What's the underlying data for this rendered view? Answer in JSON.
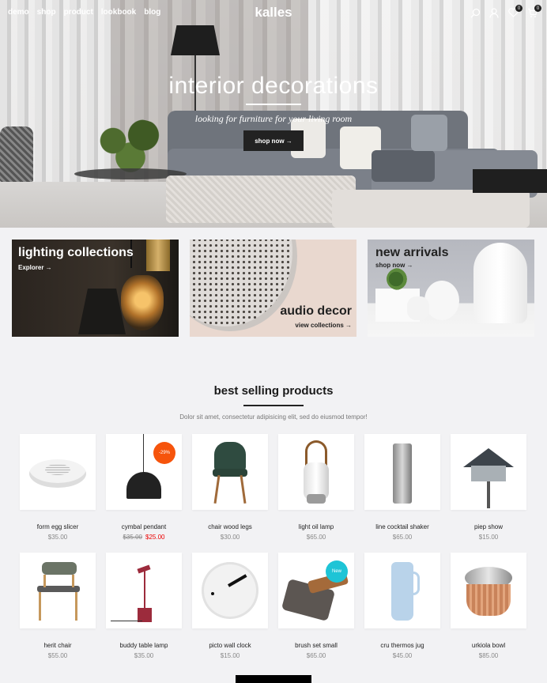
{
  "header": {
    "nav": [
      "demo",
      "shop",
      "product",
      "lookbook",
      "blog"
    ],
    "logo": "kalles",
    "icons": [
      "search-icon",
      "user-icon",
      "heart-icon",
      "cart-icon"
    ],
    "wishlist_count": "0",
    "cart_count": "0"
  },
  "hero": {
    "title": "interior decorations",
    "subtitle": "looking for furniture for your living room",
    "button": "shop now →"
  },
  "banners": [
    {
      "title": "lighting collections",
      "link": "Explorer →"
    },
    {
      "title": "audio decor",
      "link": "view collections →"
    },
    {
      "title": "new arrivals",
      "link": "shop now →"
    }
  ],
  "section": {
    "title": "best selling products",
    "subtitle": "Dolor sit amet, consectetur adipisicing elit, sed do eiusmod tempor!"
  },
  "products": [
    {
      "name": "form egg slicer",
      "price": "$35.00"
    },
    {
      "name": "cymbal pendant",
      "old_price": "$35.00",
      "price": "$25.00",
      "badge": "-29%"
    },
    {
      "name": "chair wood legs",
      "price": "$30.00"
    },
    {
      "name": "light oil lamp",
      "price": "$65.00"
    },
    {
      "name": "line cocktail shaker",
      "price": "$65.00"
    },
    {
      "name": "piep show",
      "price": "$15.00"
    },
    {
      "name": "herit chair",
      "price": "$55.00"
    },
    {
      "name": "buddy table lamp",
      "price": "$35.00"
    },
    {
      "name": "picto wall clock",
      "price": "$15.00"
    },
    {
      "name": "brush set small",
      "price": "$65.00",
      "badge": "New"
    },
    {
      "name": "cru thermos jug",
      "price": "$45.00"
    },
    {
      "name": "urkiola bowl",
      "price": "$85.00"
    }
  ],
  "colors": {
    "accent_dark": "#222222",
    "sale_red": "#ec0101",
    "sale_badge": "#f6540c",
    "new_badge": "#1ec4d6"
  }
}
